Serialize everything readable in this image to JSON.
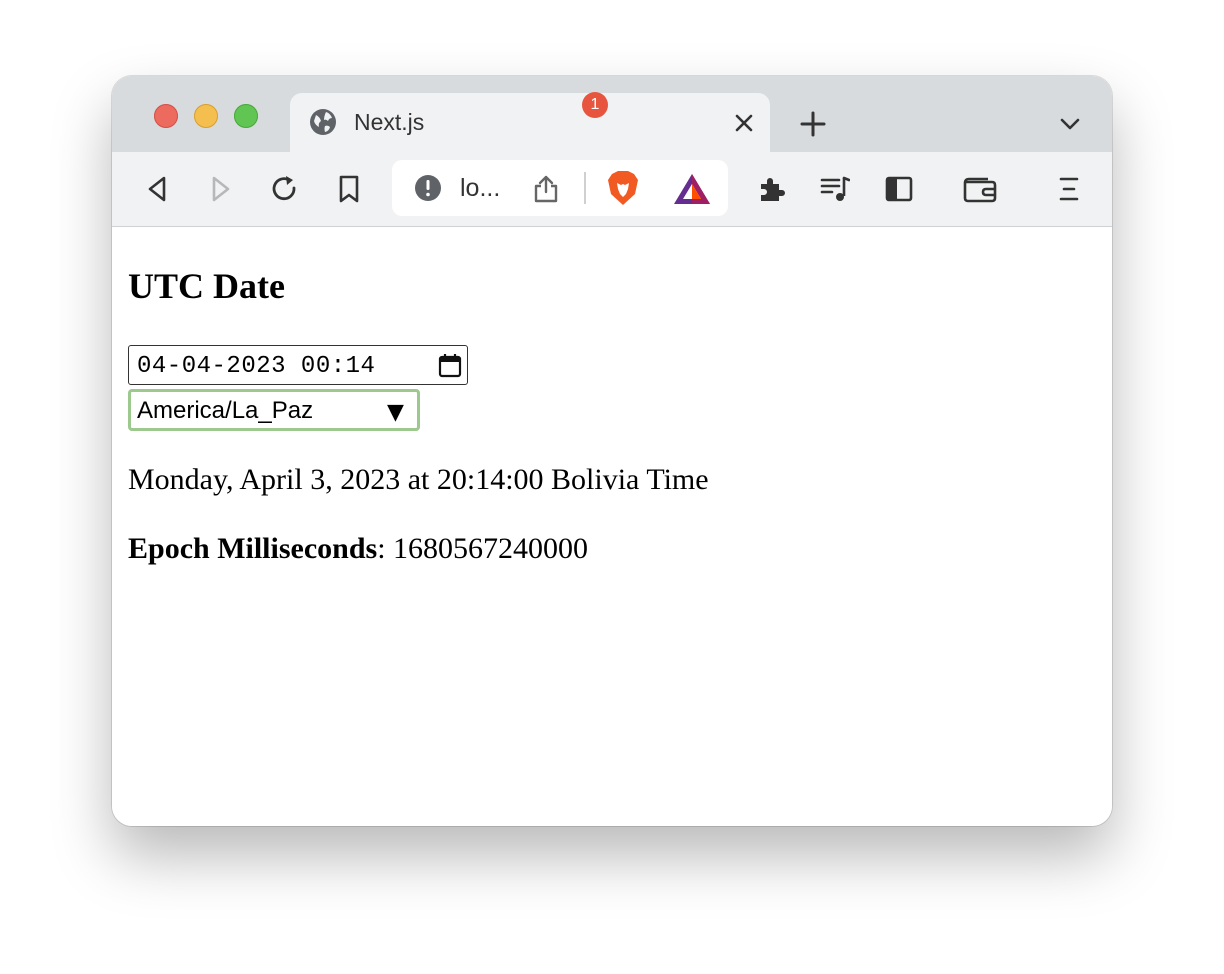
{
  "browser": {
    "tab": {
      "title": "Next.js"
    },
    "omnibox": {
      "url_text": "lo..."
    },
    "notification_badge": "1"
  },
  "page": {
    "heading": "UTC Date",
    "datetime_input": {
      "value": "04-04-2023 00:14"
    },
    "timezone_select": {
      "selected": "America/La_Paz",
      "arrow": "▼"
    },
    "formatted_date": "Monday, April 3, 2023 at 20:14:00 Bolivia Time",
    "epoch": {
      "label": "Epoch Milliseconds",
      "separator": ": ",
      "value": "1680567240000"
    }
  },
  "colors": {
    "tabstrip": "#d8dbde",
    "toolbar": "#f1f2f3",
    "select_focus_border": "#9dc98e",
    "badge": "#e8553f",
    "brave_orange": "#f15a22",
    "bat_purple": "#662d91"
  },
  "icons": {
    "tab": "globe-icon",
    "toolbar": [
      "back-icon",
      "forward-icon",
      "reload-icon",
      "bookmark-icon",
      "extensions-icon",
      "playlist-icon",
      "sidebar-icon",
      "wallet-icon",
      "menu-icon"
    ],
    "omnibox": [
      "info-icon",
      "share-icon",
      "brave-shields-icon",
      "brave-rewards-icon"
    ]
  }
}
